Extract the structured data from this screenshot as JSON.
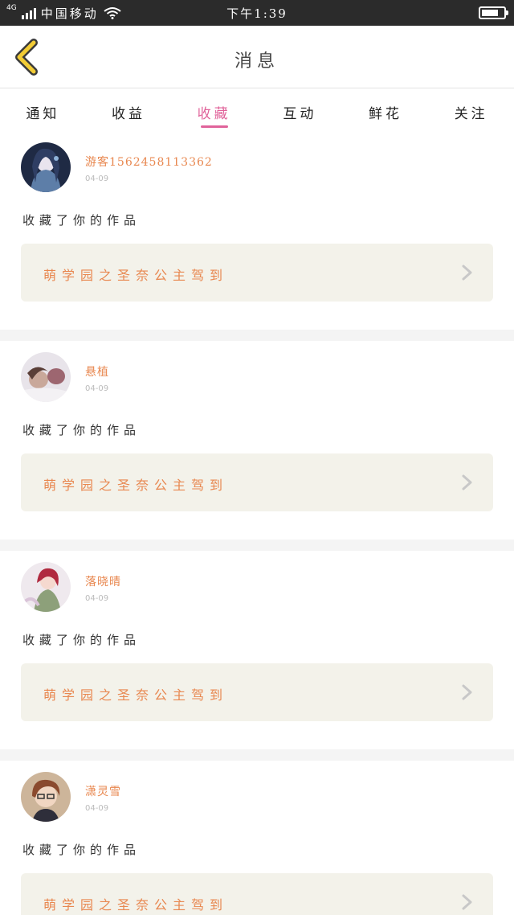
{
  "status_bar": {
    "network": "4G",
    "carrier": "中国移动",
    "time": "下午1:39",
    "battery_level": 0.75
  },
  "header": {
    "title": "消息"
  },
  "tabs": [
    {
      "label": "通知",
      "active": false
    },
    {
      "label": "收益",
      "active": false
    },
    {
      "label": "收藏",
      "active": true
    },
    {
      "label": "互动",
      "active": false
    },
    {
      "label": "鲜花",
      "active": false
    },
    {
      "label": "关注",
      "active": false
    }
  ],
  "items": [
    {
      "username": "游客1562458113362",
      "date": "04-09",
      "action": "收藏了你的作品",
      "work_title": "萌学园之圣奈公主驾到",
      "avatar": "avatar-girl-blue-icon"
    },
    {
      "username": "悬植",
      "date": "04-09",
      "action": "收藏了你的作品",
      "work_title": "萌学园之圣奈公主驾到",
      "avatar": "avatar-photo-icon"
    },
    {
      "username": "落晓晴",
      "date": "04-09",
      "action": "收藏了你的作品",
      "work_title": "萌学园之圣奈公主驾到",
      "avatar": "avatar-girl-red-icon"
    },
    {
      "username": "潇灵雪",
      "date": "04-09",
      "action": "收藏了你的作品",
      "work_title": "萌学园之圣奈公主驾到",
      "avatar": "avatar-boy-icon"
    }
  ],
  "colors": {
    "accent": "#e0639a",
    "name_orange": "#e8874f",
    "back_yellow": "#f2cc35",
    "card_bg": "#f3f2ea"
  }
}
